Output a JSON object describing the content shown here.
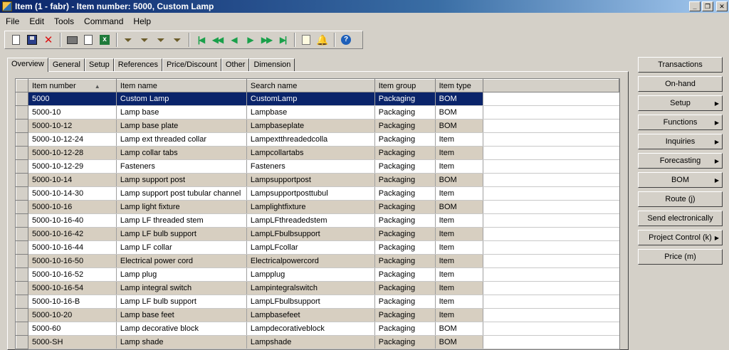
{
  "window": {
    "title": "Item (1 - fabr) - Item number: 5000, Custom Lamp",
    "minimize": "_",
    "restore": "❐",
    "close": "✕"
  },
  "menu": [
    "File",
    "Edit",
    "Tools",
    "Command",
    "Help"
  ],
  "toolbar_icons": [
    "new-icon",
    "save-icon",
    "delete-icon",
    "print-icon",
    "print-preview-icon",
    "excel-icon",
    "filter-by-selection-icon",
    "filter-icon",
    "advanced-filter-icon",
    "remove-filter-icon",
    "first-record-icon",
    "previous-page-icon",
    "previous-record-icon",
    "next-record-icon",
    "next-page-icon",
    "last-record-icon",
    "document-handling-icon",
    "alert-icon",
    "help-icon"
  ],
  "tabs": [
    "Overview",
    "General",
    "Setup",
    "References",
    "Price/Discount",
    "Other",
    "Dimension"
  ],
  "active_tab": "Overview",
  "grid": {
    "columns": [
      "Item number",
      "Item name",
      "Search name",
      "Item group",
      "Item type"
    ],
    "rows": [
      [
        "5000",
        "Custom Lamp",
        "CustomLamp",
        "Packaging",
        "BOM"
      ],
      [
        "5000-10",
        "Lamp base",
        "Lampbase",
        "Packaging",
        "BOM"
      ],
      [
        "5000-10-12",
        "Lamp base plate",
        "Lampbaseplate",
        "Packaging",
        "BOM"
      ],
      [
        "5000-10-12-24",
        "Lamp ext threaded collar",
        "Lampextthreadedcolla",
        "Packaging",
        "Item"
      ],
      [
        "5000-10-12-28",
        "Lamp collar tabs",
        "Lampcollartabs",
        "Packaging",
        "Item"
      ],
      [
        "5000-10-12-29",
        "Fasteners",
        "Fasteners",
        "Packaging",
        "Item"
      ],
      [
        "5000-10-14",
        "Lamp support post",
        "Lampsupportpost",
        "Packaging",
        "BOM"
      ],
      [
        "5000-10-14-30",
        "Lamp support post tubular channel",
        "Lampsupportposttubul",
        "Packaging",
        "Item"
      ],
      [
        "5000-10-16",
        "Lamp light fixture",
        "Lamplightfixture",
        "Packaging",
        "BOM"
      ],
      [
        "5000-10-16-40",
        "Lamp LF threaded stem",
        "LampLFthreadedstem",
        "Packaging",
        "Item"
      ],
      [
        "5000-10-16-42",
        "Lamp LF bulb support",
        "LampLFbulbsupport",
        "Packaging",
        "Item"
      ],
      [
        "5000-10-16-44",
        "Lamp LF collar",
        "LampLFcollar",
        "Packaging",
        "Item"
      ],
      [
        "5000-10-16-50",
        "Electrical power cord",
        "Electricalpowercord",
        "Packaging",
        "Item"
      ],
      [
        "5000-10-16-52",
        "Lamp plug",
        "Lampplug",
        "Packaging",
        "Item"
      ],
      [
        "5000-10-16-54",
        "Lamp integral switch",
        "Lampintegralswitch",
        "Packaging",
        "Item"
      ],
      [
        "5000-10-16-B",
        "Lamp LF bulb support",
        "LampLFbulbsupport",
        "Packaging",
        "Item"
      ],
      [
        "5000-10-20",
        "Lamp base feet",
        "Lampbasefeet",
        "Packaging",
        "Item"
      ],
      [
        "5000-60",
        "Lamp decorative block",
        "Lampdecorativeblock",
        "Packaging",
        "BOM"
      ],
      [
        "5000-SH",
        "Lamp shade",
        "Lampshade",
        "Packaging",
        "BOM"
      ]
    ]
  },
  "buttons": [
    {
      "label": "Transactions",
      "submenu": false
    },
    {
      "label": "On-hand",
      "submenu": false
    },
    {
      "label": "Setup",
      "submenu": true
    },
    {
      "label": "Functions",
      "submenu": true
    },
    {
      "label": "Inquiries",
      "submenu": true
    },
    {
      "label": "Forecasting",
      "submenu": true
    },
    {
      "label": "BOM",
      "submenu": true
    },
    {
      "label": "Route (j)",
      "submenu": false
    },
    {
      "label": "Send electronically",
      "submenu": false
    },
    {
      "label": "Project Control (k)",
      "submenu": true
    },
    {
      "label": "Price (m)",
      "submenu": false
    }
  ],
  "colors": {
    "selected_row": "#0a246a",
    "alt_row": "#d7cfc1",
    "title_bar": "#0a246a"
  }
}
